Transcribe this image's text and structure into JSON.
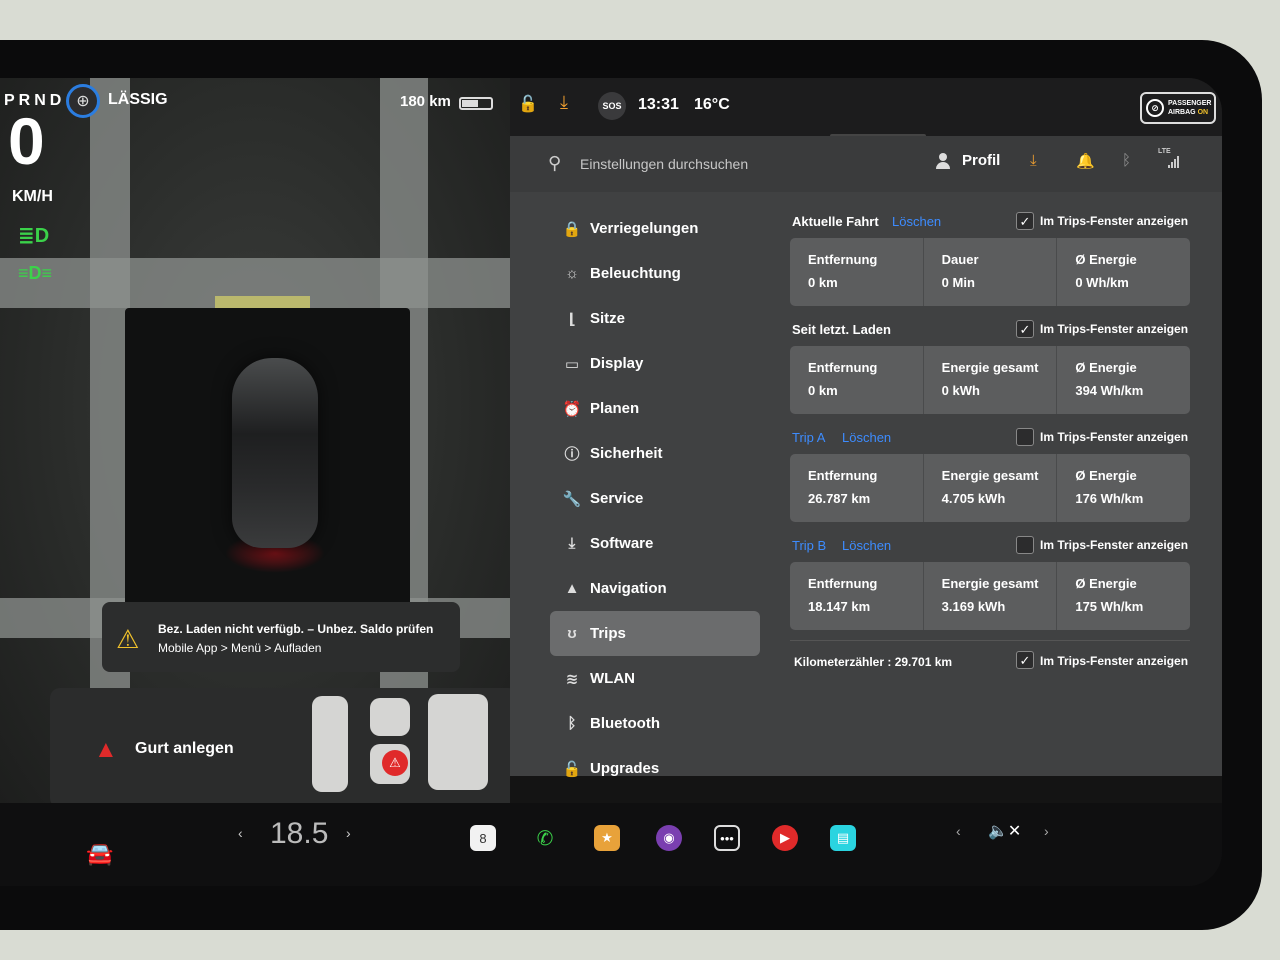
{
  "drive": {
    "gears": "PRND",
    "mode": "LÄSSIG",
    "range": "180 km",
    "speed": "0",
    "speed_unit": "KM/H"
  },
  "status": {
    "time": "13:31",
    "temperature": "16°C",
    "sos": "SOS",
    "airbag_line1": "PASSENGER",
    "airbag_line2": "AIRBAG",
    "airbag_state": "ON"
  },
  "alerts": {
    "charge_line1": "Bez. Laden nicht verfügb. – Unbez. Saldo prüfen",
    "charge_line2": "Mobile App > Menü > Aufladen",
    "seatbelt": "Gurt anlegen"
  },
  "search": {
    "placeholder": "Einstellungen durchsuchen"
  },
  "header": {
    "profile": "Profil",
    "lte": "LTE"
  },
  "menu": [
    {
      "label": "Verriegelungen",
      "icon": "🔒"
    },
    {
      "label": "Beleuchtung",
      "icon": "☼"
    },
    {
      "label": "Sitze",
      "icon": "⌊"
    },
    {
      "label": "Display",
      "icon": "▭"
    },
    {
      "label": "Planen",
      "icon": "⏰"
    },
    {
      "label": "Sicherheit",
      "icon": "ⓘ"
    },
    {
      "label": "Service",
      "icon": "🔧"
    },
    {
      "label": "Software",
      "icon": "⤓"
    },
    {
      "label": "Navigation",
      "icon": "▲"
    },
    {
      "label": "Trips",
      "icon": "ʊ"
    },
    {
      "label": "WLAN",
      "icon": "≋"
    },
    {
      "label": "Bluetooth",
      "icon": "ᛒ"
    },
    {
      "label": "Upgrades",
      "icon": "🔓"
    }
  ],
  "trips": {
    "show_label": "Im Trips-Fenster anzeigen",
    "clear_label": "Löschen",
    "current": {
      "title": "Aktuelle Fahrt",
      "stats": [
        {
          "k": "Entfernung",
          "v": "0 km"
        },
        {
          "k": "Dauer",
          "v": "0 Min"
        },
        {
          "k": "Ø Energie",
          "v": "0 Wh/km"
        }
      ]
    },
    "since_charge": {
      "title": "Seit letzt. Laden",
      "stats": [
        {
          "k": "Entfernung",
          "v": "0 km"
        },
        {
          "k": "Energie gesamt",
          "v": "0 kWh"
        },
        {
          "k": "Ø Energie",
          "v": "394 Wh/km"
        }
      ]
    },
    "trip_a": {
      "title": "Trip A",
      "stats": [
        {
          "k": "Entfernung",
          "v": "26.787 km"
        },
        {
          "k": "Energie gesamt",
          "v": "4.705 kWh"
        },
        {
          "k": "Ø Energie",
          "v": "176 Wh/km"
        }
      ]
    },
    "trip_b": {
      "title": "Trip B",
      "stats": [
        {
          "k": "Entfernung",
          "v": "18.147 km"
        },
        {
          "k": "Energie gesamt",
          "v": "3.169 kWh"
        },
        {
          "k": "Ø Energie",
          "v": "175 Wh/km"
        }
      ]
    },
    "odometer_label": "Kilometerzähler :",
    "odometer_value": "29.701 km"
  },
  "dock": {
    "cabin_temp": "18.5",
    "calendar_day": "8"
  },
  "colors": {
    "accent_blue": "#3d8cff",
    "light_green": "#3bd24a",
    "warning_yellow": "#f0c12b",
    "alert_red": "#e02a2a"
  }
}
